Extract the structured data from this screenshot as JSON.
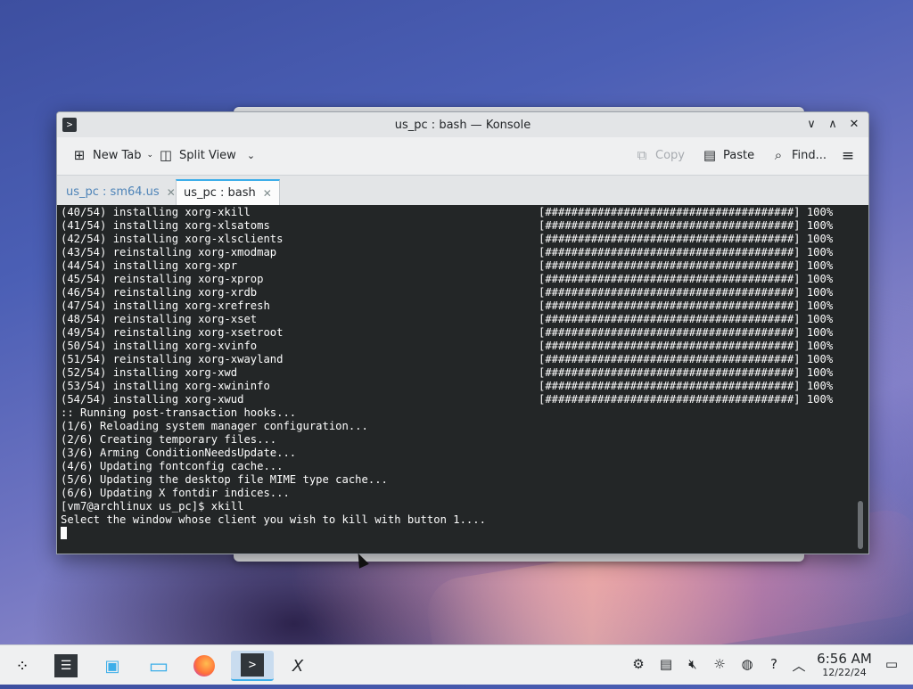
{
  "window": {
    "title": "us_pc : bash — Konsole",
    "controls": [
      "∨",
      "∧",
      "✕"
    ]
  },
  "toolbar": {
    "new_tab": "New Tab",
    "split_view": "Split View",
    "copy": "Copy",
    "paste": "Paste",
    "find": "Find..."
  },
  "tabs": [
    {
      "label": "us_pc : sm64.us",
      "active": false
    },
    {
      "label": "us_pc : bash",
      "active": true
    }
  ],
  "terminal": {
    "lines": [
      "(40/54) installing xorg-xkill",
      "(41/54) installing xorg-xlsatoms",
      "(42/54) installing xorg-xlsclients",
      "(43/54) reinstalling xorg-xmodmap",
      "(44/54) installing xorg-xpr",
      "(45/54) reinstalling xorg-xprop",
      "(46/54) reinstalling xorg-xrdb",
      "(47/54) installing xorg-xrefresh",
      "(48/54) reinstalling xorg-xset",
      "(49/54) reinstalling xorg-xsetroot",
      "(50/54) installing xorg-xvinfo",
      "(51/54) reinstalling xorg-xwayland",
      "(52/54) installing xorg-xwd",
      "(53/54) installing xorg-xwininfo",
      "(54/54) installing xorg-xwud",
      ":: Running post-transaction hooks...",
      "(1/6) Reloading system manager configuration...",
      "(2/6) Creating temporary files...",
      "(3/6) Arming ConditionNeedsUpdate...",
      "(4/6) Updating fontconfig cache...",
      "(5/6) Updating the desktop file MIME type cache...",
      "(6/6) Updating X fontdir indices...",
      "[vm7@archlinux us_pc]$ xkill",
      "Select the window whose client you wish to kill with button 1...."
    ],
    "progress": [
      "[######################################] 100%",
      "[######################################] 100%",
      "[######################################] 100%",
      "[######################################] 100%",
      "[######################################] 100%",
      "[######################################] 100%",
      "[######################################] 100%",
      "[######################################] 100%",
      "[######################################] 100%",
      "[######################################] 100%",
      "[######################################] 100%",
      "[######################################] 100%",
      "[######################################] 100%",
      "[######################################] 100%",
      "[######################################] 100%"
    ]
  },
  "taskbar": {
    "apps": [
      "app-launcher-icon",
      "system-settings-icon",
      "discover-store-icon",
      "file-manager-icon",
      "firefox-icon",
      "konsole-icon",
      "xkill-icon"
    ],
    "tray_icons": [
      "network-icon",
      "clipboard-icon",
      "volume-muted-icon",
      "brightness-icon",
      "globe-icon",
      "help-icon",
      "expand-tray-icon"
    ],
    "time": "6:56 AM",
    "date": "12/22/24"
  },
  "colors": {
    "accent": "#3daee9",
    "terminal_bg": "#232627",
    "terminal_fg": "#fcfcfc"
  }
}
